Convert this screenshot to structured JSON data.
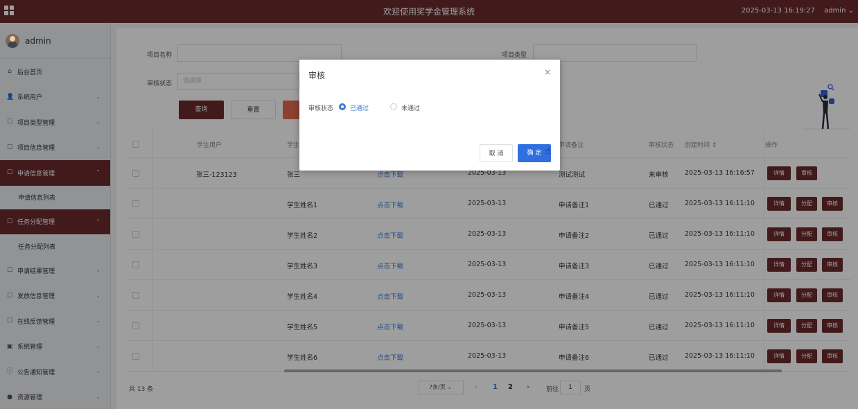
{
  "topbar": {
    "title": "欢迎使用奖学金管理系统",
    "datetime": "2025-03-13 16:19:27",
    "user": "admin",
    "user_caret": "⌄"
  },
  "sidebar": {
    "username": "admin",
    "items": [
      {
        "label": "后台首页",
        "icon": "home-icon",
        "glyph": "⌂"
      },
      {
        "label": "系统用户",
        "icon": "user-icon",
        "glyph": "👤",
        "chevron": "⌄"
      },
      {
        "label": "项目类型管理",
        "icon": "doc-icon",
        "glyph": "☐",
        "chevron": "⌄"
      },
      {
        "label": "项目信息管理",
        "icon": "doc-icon",
        "glyph": "☐",
        "chevron": "⌄"
      },
      {
        "label": "申请信息管理",
        "icon": "doc-icon",
        "glyph": "☐",
        "chevron": "⌃"
      },
      {
        "label": "申请信息列表"
      },
      {
        "label": "任务分配管理",
        "icon": "doc-icon",
        "glyph": "☐",
        "chevron": "⌃"
      },
      {
        "label": "任务分配列表"
      },
      {
        "label": "申请结果管理",
        "icon": "doc-icon",
        "glyph": "☐",
        "chevron": "⌄"
      },
      {
        "label": "发放信息管理",
        "icon": "doc-icon",
        "glyph": "☐",
        "chevron": "⌄"
      },
      {
        "label": "在线反馈管理",
        "icon": "doc-icon",
        "glyph": "☐",
        "chevron": "⌄"
      },
      {
        "label": "系统管理",
        "icon": "system-icon",
        "glyph": "▣",
        "chevron": "⌄"
      },
      {
        "label": "公告通知管理",
        "icon": "info-icon",
        "glyph": "ⓘ",
        "chevron": "⌄"
      },
      {
        "label": "资源管理",
        "icon": "resource-icon",
        "glyph": "●",
        "chevron": "⌄"
      }
    ]
  },
  "filters": {
    "project_name_label": "项目名称",
    "project_type_label": "项目类型",
    "audit_status_label": "审核状态",
    "audit_status_placeholder": "请选择",
    "query_button": "查询",
    "reset_button": "重置"
  },
  "table": {
    "headers": [
      "学生用户",
      "学生",
      "申请备注",
      "审核状态",
      "创建时间 ⇕",
      "操作"
    ],
    "rows": [
      {
        "user": "张三-123123",
        "name": "张三",
        "file": "点击下载",
        "date": "2025-03-13",
        "remark": "测试测试",
        "status": "未审核",
        "created": "2025-03-13 16:16:57",
        "ops": [
          "详情",
          "审核"
        ]
      },
      {
        "user": "",
        "name": "学生姓名1",
        "file": "点击下载",
        "date": "2025-03-13",
        "remark": "申请备注1",
        "status": "已通过",
        "created": "2025-03-13 16:11:10",
        "ops": [
          "详情",
          "分配",
          "审核"
        ]
      },
      {
        "user": "",
        "name": "学生姓名2",
        "file": "点击下载",
        "date": "2025-03-13",
        "remark": "申请备注2",
        "status": "已通过",
        "created": "2025-03-13 16:11:10",
        "ops": [
          "详情",
          "分配",
          "审核"
        ]
      },
      {
        "user": "",
        "name": "学生姓名3",
        "file": "点击下载",
        "date": "2025-03-13",
        "remark": "申请备注3",
        "status": "已通过",
        "created": "2025-03-13 16:11:10",
        "ops": [
          "详情",
          "分配",
          "审核"
        ]
      },
      {
        "user": "",
        "name": "学生姓名4",
        "file": "点击下载",
        "date": "2025-03-13",
        "remark": "申请备注4",
        "status": "已通过",
        "created": "2025-03-13 16:11:10",
        "ops": [
          "详情",
          "分配",
          "审核"
        ]
      },
      {
        "user": "",
        "name": "学生姓名5",
        "file": "点击下载",
        "date": "2025-03-13",
        "remark": "申请备注5",
        "status": "已通过",
        "created": "2025-03-13 16:11:10",
        "ops": [
          "详情",
          "分配",
          "审核"
        ]
      },
      {
        "user": "",
        "name": "学生姓名6",
        "file": "点击下载",
        "date": "2025-03-13",
        "remark": "申请备注6",
        "status": "已通过",
        "created": "2025-03-13 16:11:10",
        "ops": [
          "详情",
          "分配",
          "审核"
        ]
      }
    ]
  },
  "pagination": {
    "total": "共 13 条",
    "page_size": "7条/页",
    "page_size_caret": "⌄",
    "prev": "‹",
    "pages": [
      "1",
      "2"
    ],
    "next": "›",
    "goto_label": "前往",
    "goto_value": "1",
    "goto_suffix": "页"
  },
  "modal": {
    "title": "审核",
    "close": "×",
    "field_label": "审核状态",
    "options": [
      "已通过",
      "未通过"
    ],
    "selected": "已通过",
    "cancel": "取 消",
    "confirm": "确 定"
  },
  "colors": {
    "brand": "#6b2a2c",
    "link": "#3a7bd5",
    "confirm": "#2f6fe0",
    "reset_red": "#e3694f"
  }
}
